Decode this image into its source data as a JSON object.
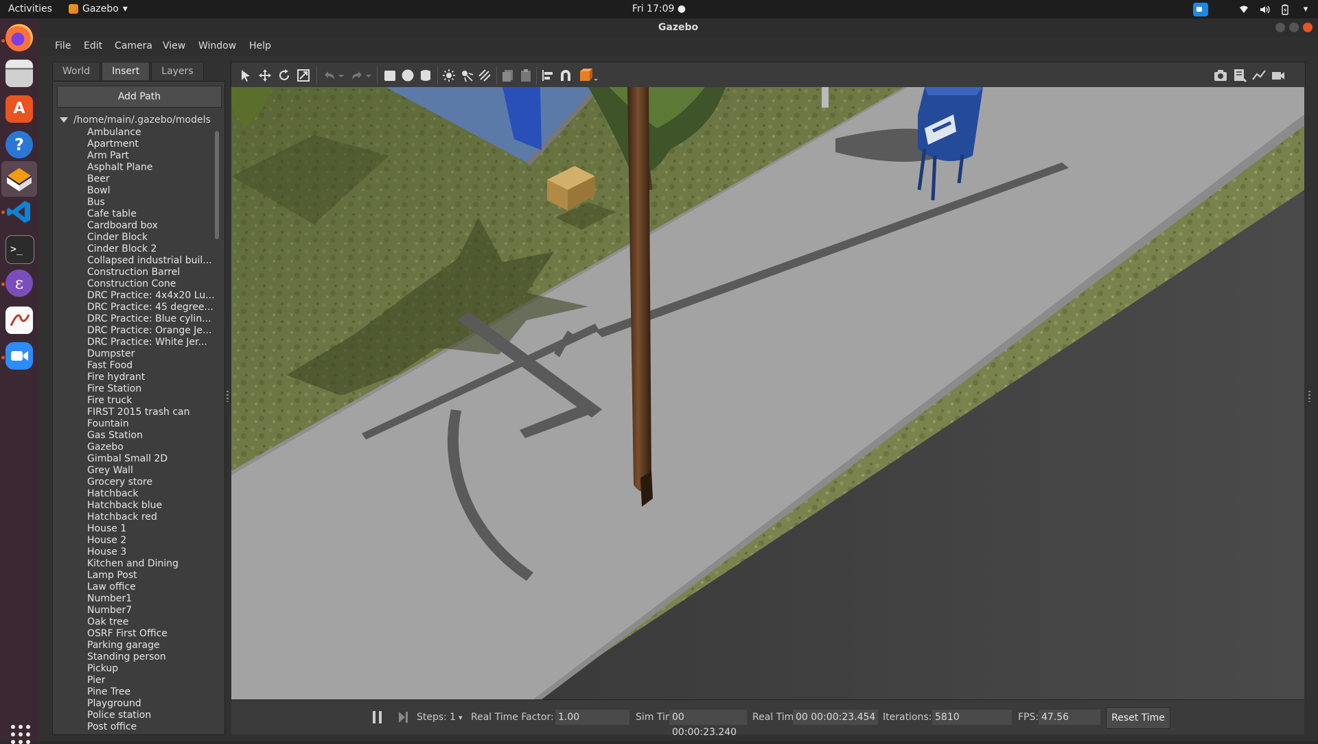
{
  "topbar": {
    "activities": "Activities",
    "app_name": "Gazebo",
    "clock": "Fri 17:09 ●"
  },
  "dock": {
    "items": [
      "firefox-icon",
      "files-icon",
      "software-center-icon",
      "help-icon",
      "gazebo-icon",
      "vscode-icon",
      "terminal-icon",
      "emacs-icon",
      "pdf-viewer-icon",
      "zoom-icon"
    ]
  },
  "window": {
    "title": "Gazebo"
  },
  "menu": {
    "file": "File",
    "edit": "Edit",
    "camera": "Camera",
    "view": "View",
    "window": "Window",
    "help": "Help"
  },
  "left_panel": {
    "tabs": [
      "World",
      "Insert",
      "Layers"
    ],
    "active_tab": "Insert",
    "add_path": "Add Path",
    "root_path": "/home/main/.gazebo/models",
    "models": [
      "Ambulance",
      "Apartment",
      "Arm Part",
      "Asphalt Plane",
      "Beer",
      "Bowl",
      "Bus",
      "Cafe table",
      "Cardboard box",
      "Cinder Block",
      "Cinder Block 2",
      "Collapsed industrial buil...",
      "Construction Barrel",
      "Construction Cone",
      "DRC Practice: 4x4x20 Lu...",
      "DRC Practice: 45 degree...",
      "DRC Practice: Blue cylin...",
      "DRC Practice: Orange Je...",
      "DRC Practice: White Jer...",
      "Dumpster",
      "Fast Food",
      "Fire hydrant",
      "Fire Station",
      "Fire truck",
      "FIRST 2015 trash can",
      "Fountain",
      "Gas Station",
      "Gazebo",
      "Gimbal Small 2D",
      "Grey Wall",
      "Grocery store",
      "Hatchback",
      "Hatchback blue",
      "Hatchback red",
      "House 1",
      "House 2",
      "House 3",
      "Kitchen and Dining",
      "Lamp Post",
      "Law office",
      "Number1",
      "Number7",
      "Oak tree",
      "OSRF First Office",
      "Parking garage",
      "Standing person",
      "Pickup",
      "Pier",
      "Pine Tree",
      "Playground",
      "Police station",
      "Post office"
    ]
  },
  "toolbar": {
    "tools": [
      "select-mode-icon",
      "translate-mode-icon",
      "rotate-mode-icon",
      "scale-mode-icon",
      "undo-icon",
      "undo-history-icon",
      "redo-icon",
      "redo-history-icon",
      "box-shape-icon",
      "sphere-shape-icon",
      "cylinder-shape-icon",
      "point-light-icon",
      "spot-light-icon",
      "directional-light-icon",
      "copy-icon",
      "paste-icon",
      "align-icon",
      "snap-icon",
      "change-view-icon"
    ],
    "right_tools": [
      "screenshot-icon",
      "log-icon",
      "plot-icon",
      "record-video-icon"
    ],
    "accent": "#e67e22"
  },
  "bottombar": {
    "steps_label": "Steps:",
    "steps_value": "1",
    "rtf_label": "Real Time Factor:",
    "rtf_value": "1.00",
    "sim_time_label": "Sim Time:",
    "sim_time_value": "00 00:00:23.240",
    "real_time_label": "Real Time:",
    "real_time_value": "00 00:00:23.454",
    "iterations_label": "Iterations:",
    "iterations_value": "5810",
    "fps_label": "FPS:",
    "fps_value": "47.56",
    "reset_time": "Reset Time"
  }
}
